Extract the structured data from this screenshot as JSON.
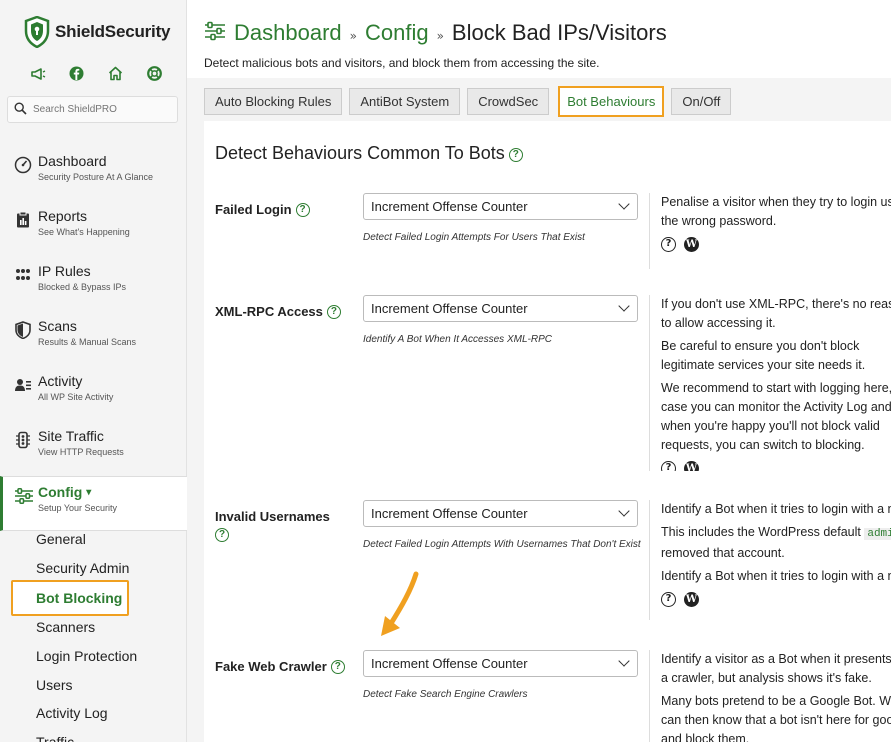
{
  "brand": {
    "name": "ShieldSecurity",
    "accent": "#2e7d32",
    "highlight": "#f0a020"
  },
  "quick_icons": [
    "megaphone-icon",
    "facebook-icon",
    "home-icon",
    "support-icon"
  ],
  "search": {
    "placeholder": "Search ShieldPRO"
  },
  "nav": [
    {
      "title": "Dashboard",
      "subtitle": "Security Posture At A Glance",
      "icon": "dashboard-icon"
    },
    {
      "title": "Reports",
      "subtitle": "See What's Happening",
      "icon": "reports-icon"
    },
    {
      "title": "IP Rules",
      "subtitle": "Blocked & Bypass IPs",
      "icon": "ip-rules-icon"
    },
    {
      "title": "Scans",
      "subtitle": "Results & Manual Scans",
      "icon": "shield-icon"
    },
    {
      "title": "Activity",
      "subtitle": "All WP Site Activity",
      "icon": "activity-icon"
    },
    {
      "title": "Site Traffic",
      "subtitle": "View HTTP Requests",
      "icon": "traffic-icon"
    },
    {
      "title": "Config",
      "subtitle": "Setup Your Security",
      "icon": "sliders-icon",
      "caret": "▾"
    }
  ],
  "config_sub": [
    "General",
    "Security Admin",
    "Bot Blocking",
    "Scanners",
    "Login Protection",
    "Users",
    "Activity Log",
    "Traffic"
  ],
  "breadcrumb": {
    "item1": "Dashboard",
    "item2": "Config",
    "current": "Block Bad IPs/Visitors",
    "sep": "»"
  },
  "page_subtitle": "Detect malicious bots and visitors, and block them from accessing the site.",
  "tabs": [
    "Auto Blocking Rules",
    "AntiBot System",
    "CrowdSec",
    "Bot Behaviours",
    "On/Off"
  ],
  "section_title": "Detect Behaviours Common To Bots",
  "options": [
    {
      "label": "Failed Login",
      "value": "Increment Offense Counter",
      "hint": "Detect Failed Login Attempts For Users That Exist",
      "desc": [
        "Penalise a visitor when they try to login using the wrong password."
      ]
    },
    {
      "label": "XML-RPC Access",
      "value": "Increment Offense Counter",
      "hint": "Identify A Bot When It Accesses XML-RPC",
      "desc": [
        "If you don't use XML-RPC, there's no reason to allow accessing it.",
        "Be careful to ensure you don't block legitimate services your site needs it.",
        "We recommend to start with logging here, in-case you can monitor the Activity Log and when you're happy you'll not block valid requests, you can switch to blocking."
      ]
    },
    {
      "label": "Invalid Usernames",
      "value": "Increment Offense Counter",
      "hint": "Detect Failed Login Attempts With Usernames That Don't Exist",
      "desc": [
        "Identify a Bot when it tries to login with a non-existent username.",
        "This includes the WordPress default",
        "removed that account.",
        "Identify a Bot when it tries to login with a non-existent username."
      ],
      "code": "admin"
    },
    {
      "label": "Fake Web Crawler",
      "value": "Increment Offense Counter",
      "hint": "Detect Fake Search Engine Crawlers",
      "desc": [
        "Identify a visitor as a Bot when it presents as a crawler, but analysis shows it's fake.",
        "Many bots pretend to be a Google Bot. We can then know that a bot isn't here for good and block them."
      ]
    }
  ]
}
